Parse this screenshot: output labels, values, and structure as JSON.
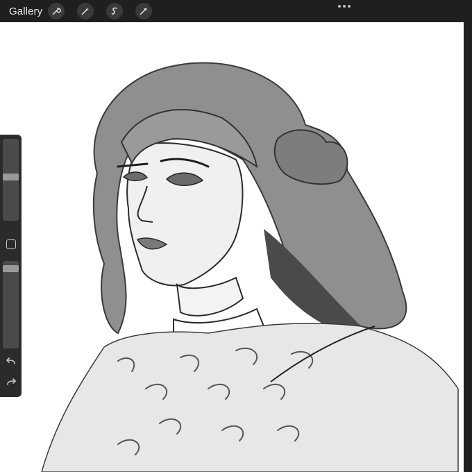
{
  "topbar": {
    "gallery_label": "Gallery",
    "tools": [
      {
        "name": "actions-wrench-icon"
      },
      {
        "name": "adjustments-wand-icon"
      },
      {
        "name": "selection-s-icon"
      },
      {
        "name": "transform-arrow-icon"
      }
    ],
    "more_icon": "more-dots-icon"
  },
  "sidebar": {
    "brush_size_level": 0.33,
    "opacity_level": 0.08,
    "undo_icon": "undo-icon",
    "redo_icon": "redo-icon",
    "modify_icon": "modify-square-icon"
  },
  "colors": {
    "chrome": "#1f1f1f",
    "canvas": "#ffffff"
  }
}
